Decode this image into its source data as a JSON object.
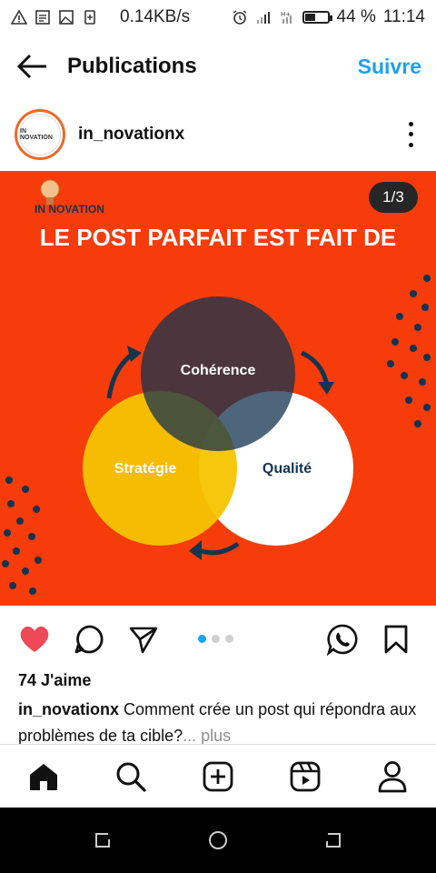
{
  "status_bar": {
    "network_speed": "0.14KB/s",
    "battery_percent": "44 %",
    "battery_level": 0.44,
    "time": "11:14"
  },
  "header": {
    "title": "Publications",
    "follow_label": "Suivre"
  },
  "post": {
    "username": "in_novationx",
    "avatar_text": "IN NOVATION",
    "page_counter": "1/3",
    "image": {
      "logo_text": "IN NOVATION",
      "headline": "LE POST PARFAIT EST FAIT DE",
      "circles": [
        {
          "label": "Cohérence",
          "color": "#14344f"
        },
        {
          "label": "Stratégie",
          "color": "#f6c400"
        },
        {
          "label": "Qualité",
          "color": "#ffffff"
        }
      ],
      "background_color": "#f53c0a"
    },
    "carousel": {
      "count": 3,
      "active_index": 0
    },
    "likes": "74 J'aime",
    "caption_user": "in_novationx",
    "caption_text": " Comment crée un post qui répondra aux problèmes de ta cible?",
    "caption_more": "... plus"
  },
  "colors": {
    "accent": "#1da1f2",
    "like": "#ed4956"
  },
  "icons": {
    "status_left": [
      "warning-icon",
      "message-icon",
      "image-icon",
      "sim-icon"
    ],
    "status_right": [
      "alarm-icon",
      "signal-icon",
      "data-icon",
      "battery-icon"
    ],
    "actions": [
      "heart-icon",
      "comment-icon",
      "share-icon",
      "whatsapp-icon",
      "bookmark-icon"
    ],
    "nav": [
      "home-icon",
      "search-icon",
      "create-icon",
      "reels-icon",
      "profile-icon"
    ],
    "system": [
      "recents-icon",
      "home-circle-icon",
      "back-icon"
    ]
  }
}
